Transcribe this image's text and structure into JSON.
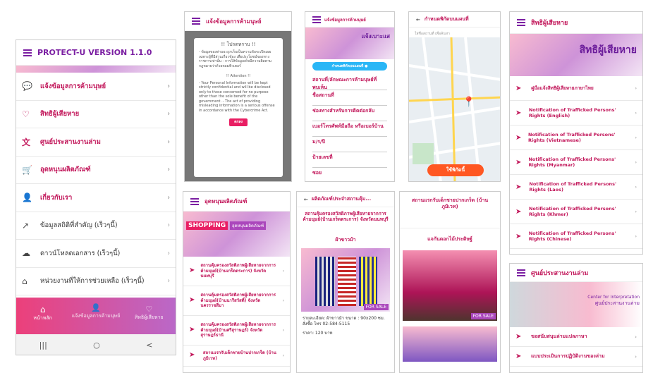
{
  "s1": {
    "title": "PROTECT-U VERSION 1.1.0",
    "menu": [
      "แจ้งข้อมูลการค้ามนุษย์",
      "สิทธิผู้เสียหาย",
      "ศูนย์ประสานงานล่าม",
      "อุดหนุนผลิตภัณฑ์",
      "เกี่ยวกับเรา",
      "ข้อมูลสถิติที่สำคัญ (เร็วๆนี้)",
      "ดาวน์โหลดเอกสาร (เร็วๆนี้)",
      "หน่วยงานที่ให้การช่วยเหลือ (เร็วๆนี้)"
    ],
    "tabs": [
      "หน้าหลัก",
      "แจ้งข้อมูลการค้ามนุษย์",
      "สิทธิผู้เสียหาย"
    ],
    "nav": [
      "|||",
      "○",
      "<"
    ]
  },
  "s2": {
    "title": "แจ้งข้อมูลการค้ามนุษย์",
    "notice": "!! โปรดทราบ !!",
    "th": "- ข้อมูลของท่านจะถูกเก็บเป็นความลับจะเปิดเผยเฉพาะผู้ที่มีส่วนเกี่ยวข้อง เพื่อประโยชน์ของทางราชการเท่านั้น - การให้ข้อมูลเท็จมีความผิดตามกฎหมายว่าด้วยคอมพิวเตอร์",
    "att": "!! Attention !!",
    "en": "- Your Personal Information will be kept strictly confidential and will be disclosed only to those concerned for no purpose other than the sole benefit of the government. - The act of providing misleading information is a serious offense in accordance with the Cybercrime Act.",
    "btn": "ตกลง"
  },
  "s3": {
    "title": "แจ้งข้อมูลการค้ามนุษย์",
    "banner": "แจ้งเบาะแส",
    "loc": "กำหนดพิกัดบนแผนที่",
    "fields": [
      "สถานที่/ลักษณะการค้ามนุษย์ที่พบเห็น",
      "ชื่อสถานที่",
      "ช่องทางสำหรับการติดต่อกลับ",
      "เบอร์โทรศัพท์มือถือ หรือเบอร์บ้าน",
      "ม/ร/ปี",
      "ป้ายเลขที่",
      "ซอย"
    ]
  },
  "s4": {
    "title": "กำหนดพิกัดบนแผนที่",
    "hint": "ใส่ชื่อสถานที่ เพื่อค้นหา",
    "btn": "ใช้พิกัดนี้"
  },
  "s5": {
    "title": "สิทธิผู้เสียหาย",
    "banner": "สิทธิผู้เสียหาย",
    "items": [
      "คู่มือแจ้งสิทธิผู้เสียหายภาษาไทย",
      "Notification of Trafficked Persons' Rights (English)",
      "Notification of Trafficked Persons' Rights (Vietnamese)",
      "Notification of Trafficked Persons' Rights (Myanmar)",
      "Notification of Trafficked Persons' Rights (Laos)",
      "Notification of Trafficked Persons' Rights (Khmer)",
      "Notification of Trafficked Persons' Rights (Chinese)"
    ]
  },
  "s6": {
    "title": "อุดหนุนผลิตภัณฑ์",
    "shop": "SHOPPING",
    "shop2": "อุดหนุนผลิตภัณฑ์",
    "items": [
      "สถานคุ้มครองสวัสดิภาพผู้เสียหายจากการค้ามนุษย์(บ้านเกร็ดตระการ) จังหวัดนนทบุรี",
      "สถานคุ้มครองสวัสดิภาพผู้เสียหายจากการค้ามนุษย์(บ้านนารีสวัสดิ์) จังหวัดนครราชสีมา",
      "สถานคุ้มครองสวัสดิภาพผู้เสียหายจากการค้ามนุษย์(บ้านศรีสุราษฎร์) จังหวัดสุราษฎร์ธานี",
      "สถานแรกรับเด็กชายบ้านปากเกร็ด (บ้านภูมิเวท)"
    ]
  },
  "s7": {
    "title": "ผลิตภัณฑ์ประจำสถานคุ้ม...",
    "heading": "สถานคุ้มครองสวัสดิภาพผู้เสียหายจากการค้ามนุษย์(บ้านเกร็ดตระการ) จังหวัดนนทบุรี",
    "product": "ผ้าขาวม้า",
    "sale": "FOR SALE",
    "desc": "รายละเอียด: ผ้าขาวม้า ขนาด : 90x200 ซม. สั่งซื้อ โทร 02-584-5115",
    "price": "ราคา: 120 บาท"
  },
  "s8": {
    "title": "สถานแรกรับเด็กชายปากเกร็ด (บ้านภูมิเวท)",
    "sub": "แจกันดอกไม้ประดิษฐ์",
    "sale": "FOR SALE"
  },
  "s9": {
    "title": "ศูนย์ประสานงานล่าม",
    "b1": "Center for Interpretation",
    "b2": "ศูนย์ประสานงานล่าม",
    "items": [
      "ขอสนับสนุนล่ามแปลภาษา",
      "แบบประเมินการปฏิบัติงานของล่าม"
    ]
  }
}
